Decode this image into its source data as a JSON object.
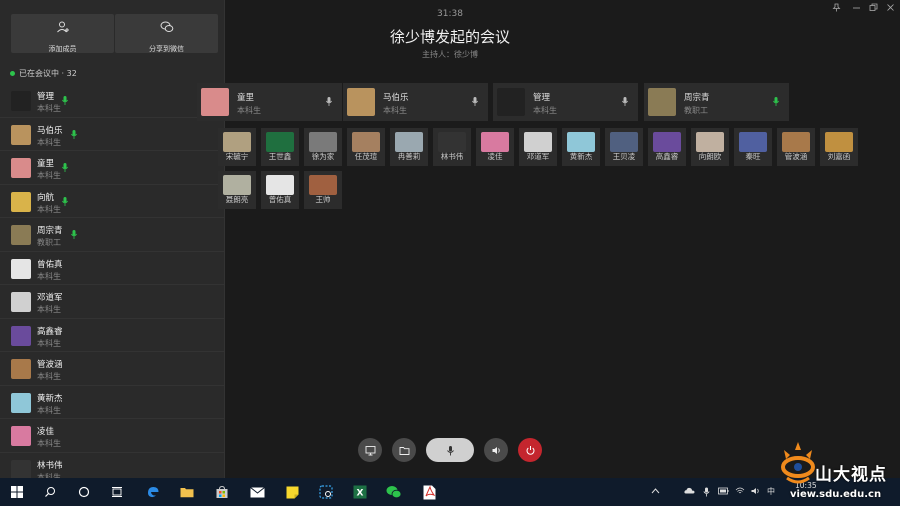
{
  "sidebar": {
    "add_member_label": "添加成员",
    "share_wechat_label": "分享到微信",
    "status": "已在会议中 · 32",
    "participants": [
      {
        "name": "管理",
        "role": "本科生",
        "speaking": true,
        "color": "#222222"
      },
      {
        "name": "马伯乐",
        "role": "本科生",
        "speaking": true,
        "color": "#b9935e"
      },
      {
        "name": "童里",
        "role": "本科生",
        "speaking": true,
        "color": "#d98b8b"
      },
      {
        "name": "向航",
        "role": "本科生",
        "speaking": true,
        "color": "#d9b34a"
      },
      {
        "name": "周宗青",
        "role": "教职工",
        "speaking": true,
        "color": "#8a7b55"
      },
      {
        "name": "曾佑真",
        "role": "本科生",
        "speaking": false,
        "color": "#e5e5e5"
      },
      {
        "name": "邓道军",
        "role": "本科生",
        "speaking": false,
        "color": "#d0d0d0"
      },
      {
        "name": "高鑫睿",
        "role": "本科生",
        "speaking": false,
        "color": "#6a4b9c"
      },
      {
        "name": "管波涵",
        "role": "本科生",
        "speaking": false,
        "color": "#a8794a"
      },
      {
        "name": "黄新杰",
        "role": "本科生",
        "speaking": false,
        "color": "#8fc7d8"
      },
      {
        "name": "凌佳",
        "role": "本科生",
        "speaking": false,
        "color": "#d87aa0"
      },
      {
        "name": "林书伟",
        "role": "本科生",
        "speaking": false,
        "color": "#333333"
      }
    ]
  },
  "header": {
    "time": "31:38",
    "title": "徐少博发起的会议",
    "host": "主持人：徐少博"
  },
  "cards": [
    {
      "name": "童里",
      "role": "本科生",
      "speaking": false,
      "color": "#d98b8b"
    },
    {
      "name": "马伯乐",
      "role": "本科生",
      "speaking": false,
      "color": "#b9935e"
    },
    {
      "name": "管理",
      "role": "本科生",
      "speaking": false,
      "color": "#222222"
    },
    {
      "name": "周宗青",
      "role": "教职工",
      "speaking": true,
      "color": "#8a7b55"
    }
  ],
  "tiles_row1": [
    {
      "name": "宋毓宁",
      "color": "#b0a080"
    },
    {
      "name": "王世鑫",
      "color": "#1f6f3f"
    },
    {
      "name": "徐为家",
      "color": "#7a7a7a"
    },
    {
      "name": "任茂瑄",
      "color": "#a58060"
    },
    {
      "name": "冉善莉",
      "color": "#9aa8b0"
    },
    {
      "name": "林书伟",
      "color": "#333333"
    },
    {
      "name": "凌佳",
      "color": "#d87aa0"
    },
    {
      "name": "邓道军",
      "color": "#d0d0d0"
    },
    {
      "name": "黄新杰",
      "color": "#8fc7d8"
    },
    {
      "name": "王贝凌",
      "color": "#506080"
    },
    {
      "name": "高鑫睿",
      "color": "#6a4b9c"
    },
    {
      "name": "向朗欧",
      "color": "#c0b0a0"
    },
    {
      "name": "秦旺",
      "color": "#5060a0"
    },
    {
      "name": "管波涵",
      "color": "#a8794a"
    },
    {
      "name": "刘嘉函",
      "color": "#c09040"
    }
  ],
  "tiles_row2": [
    {
      "name": "聂朗亮",
      "color": "#b0b0a0"
    },
    {
      "name": "曾佑真",
      "color": "#e5e5e5"
    },
    {
      "name": "王帅",
      "color": "#a06040"
    }
  ],
  "taskbar": {
    "ime": "中",
    "clock": "10:35"
  },
  "watermark": {
    "text": "山大视点",
    "url": "view.sdu.edu.cn"
  }
}
